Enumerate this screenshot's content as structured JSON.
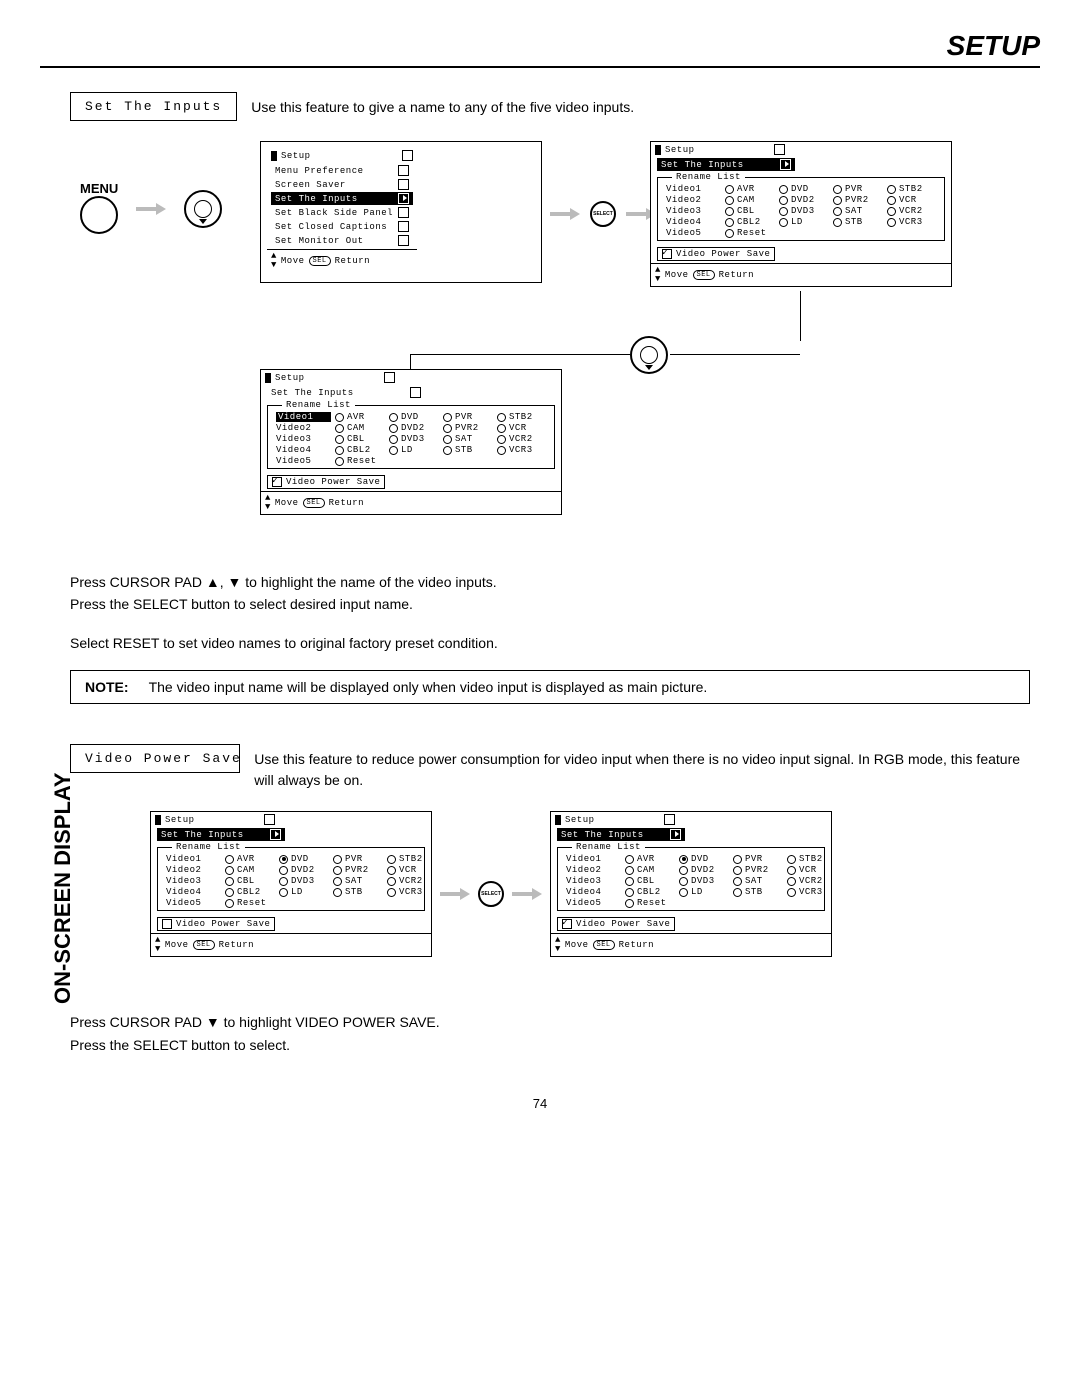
{
  "page_title": "SETUP",
  "section1": {
    "box_label": "Set The Inputs",
    "desc": "Use this feature to give a name to any of the five video inputs.",
    "menu_label": "MENU",
    "osd_setup": {
      "title": "Setup",
      "items": [
        "Menu Preference",
        "Screen Saver",
        "Set The Inputs",
        "Set Black Side Panel",
        "Set Closed Captions",
        "Set Monitor Out"
      ],
      "selected_index": 2,
      "hint_move": "Move",
      "hint_sel": "SEL",
      "hint_return": "Return"
    },
    "osd_inputs": {
      "title": "Setup",
      "subtitle": "Set The Inputs",
      "rename_label": "Rename List",
      "videos": [
        "Video1",
        "Video2",
        "Video3",
        "Video4",
        "Video5"
      ],
      "cols": [
        [
          "AVR",
          "CAM",
          "CBL",
          "CBL2",
          "Reset"
        ],
        [
          "DVD",
          "DVD2",
          "DVD3",
          "LD"
        ],
        [
          "PVR",
          "PVR2",
          "SAT",
          "STB"
        ],
        [
          "STB2",
          "VCR",
          "VCR2",
          "VCR3"
        ]
      ],
      "power_save": "Video Power Save",
      "hint_move": "Move",
      "hint_sel": "SEL",
      "hint_return": "Return"
    },
    "instr1": "Press CURSOR PAD ▲, ▼ to highlight the name of the video inputs.",
    "instr2": "Press the SELECT button to select desired input name.",
    "instr3": "Select RESET to set video names to original factory preset condition.",
    "note_label": "NOTE:",
    "note_text": "The video input name will be displayed only when video input is displayed as main picture."
  },
  "section2": {
    "vert_label": "ON-SCREEN DISPLAY",
    "box_label": "Video Power Save",
    "desc": "Use this feature to reduce power consumption for video input when there is no video input signal.  In RGB mode, this feature will always be on.",
    "instr1": "Press CURSOR PAD ▼ to highlight VIDEO POWER SAVE.",
    "instr2": "Press the SELECT button to select."
  },
  "select_label": "SELECT",
  "page_number": "74"
}
